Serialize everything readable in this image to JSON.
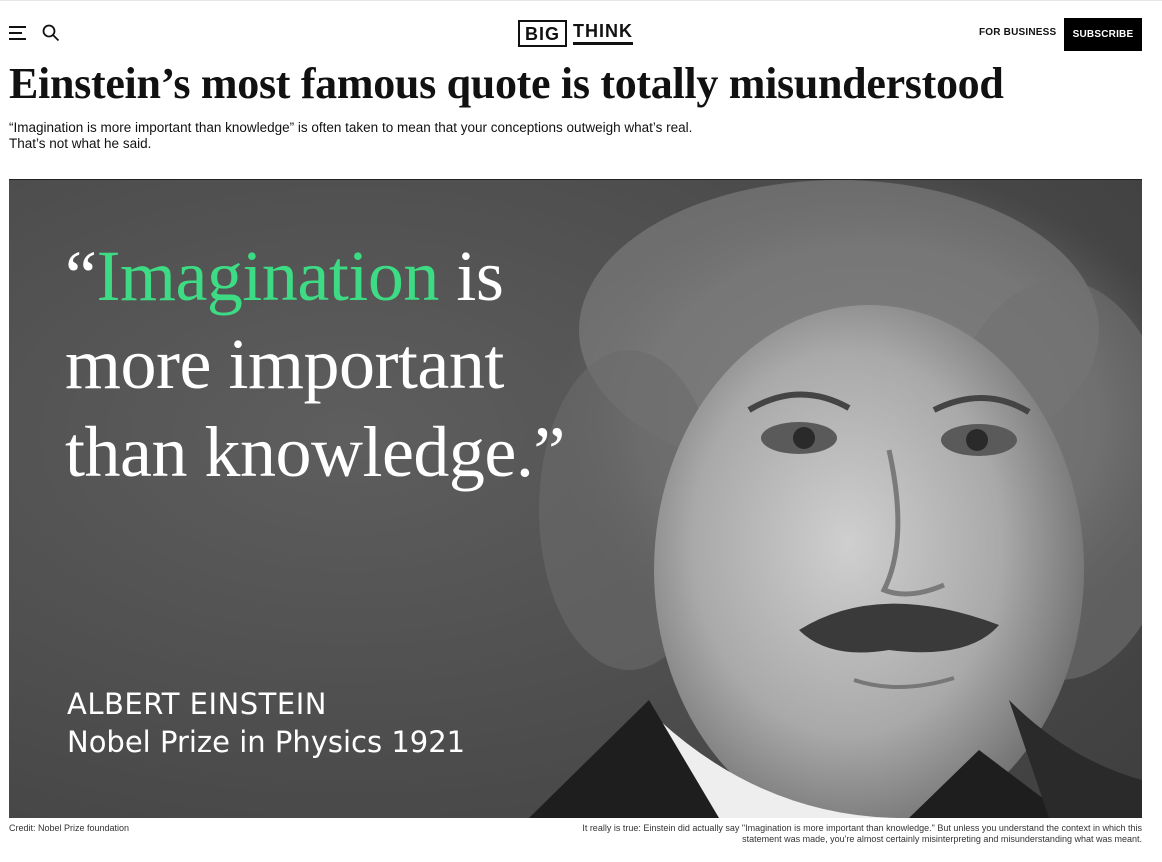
{
  "header": {
    "logo_left": "BIG",
    "logo_right": "THINK",
    "for_business_label": "FOR BUSINESS",
    "subscribe_label": "SUBSCRIBE"
  },
  "article": {
    "headline": "Einstein’s most famous quote is totally misunderstood",
    "subtitle_line1": "“Imagination is more important than knowledge” is often taken to mean that your conceptions outweigh what’s real.",
    "subtitle_line2": "That’s not what he said."
  },
  "hero": {
    "quote_open": "“",
    "quote_word_highlight": "Imagination",
    "quote_line1_rest": " is",
    "quote_line2": "more important",
    "quote_line3": "than knowledge.”",
    "attribution_name": "ALBERT EINSTEIN",
    "attribution_prize": "Nobel Prize in Physics 1921",
    "highlight_color": "#3ddc84"
  },
  "footer": {
    "credit": "Credit: Nobel Prize foundation",
    "caption": "It really is true: Einstein did actually say \"Imagination is more important than knowledge.\" But unless you understand the context in which this statement was made, you're almost certainly misinterpreting and misunderstanding what was meant."
  }
}
